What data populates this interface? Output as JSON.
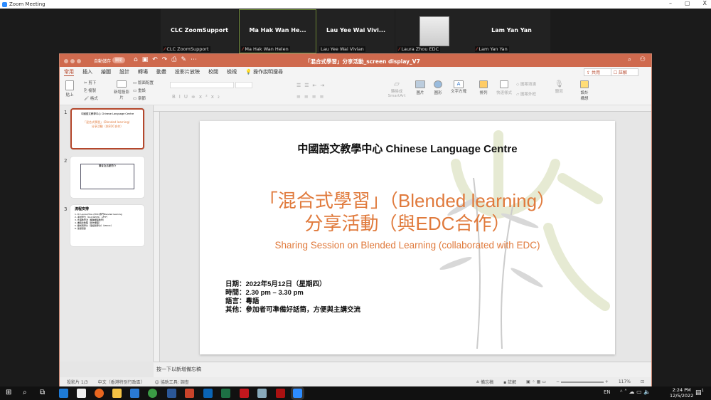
{
  "zoom": {
    "title": "Zoom Meeting",
    "window_controls": [
      "–",
      "▢",
      "X"
    ],
    "participants": [
      {
        "name": "CLC ZoomSupport",
        "label": "CLC ZoomSupport",
        "muted": true
      },
      {
        "name": "Ma Hak Wan He...",
        "label": "Ma Hak Wan Helen",
        "muted": true,
        "active": true
      },
      {
        "name": "Lau Yee Wai Vivi...",
        "label": "Lau Yee Wai Vivian",
        "muted": false
      },
      {
        "name": "",
        "label": "Laura Zhou EDC",
        "muted": true,
        "video": true
      },
      {
        "name": "Lam Yan Yan",
        "label": "Lam Yan Yan",
        "muted": true
      }
    ]
  },
  "ppt": {
    "autosave": "自動儲存",
    "autosave_state": "關閉",
    "doc_title": "「混合式學習」分享活動_screen display_V7",
    "tabs": [
      "常用",
      "插入",
      "繪圖",
      "設計",
      "轉場",
      "動畫",
      "投影片放映",
      "校閱",
      "檢視"
    ],
    "tell_me": "操作說明搜尋",
    "share": "共用",
    "comments": "註解",
    "ribbon": {
      "paste": "貼上",
      "cut": "剪下",
      "copy": "複製",
      "format": "格式",
      "new_slide": "新增投影片",
      "layout": "版面配置",
      "reset": "重設",
      "section": "章節",
      "smartart": "轉換成SmartArt",
      "picture": "圖片",
      "shapes": "圖形",
      "textbox": "文字方塊",
      "arrange": "排列",
      "quick_styles": "快速樣式",
      "shape_fill": "圖案填滿",
      "shape_outline": "圖案外框",
      "dictate": "聽寫",
      "design_ideas": "設計構想"
    },
    "thumbnails": [
      {
        "num": "1",
        "title": "中國語文教學中心 Chinese Language Centre",
        "line1": "「混合式學習」（Blended learning）",
        "line2": "分享活動（與EDC合作）"
      },
      {
        "num": "2",
        "title": "講者及活動簡介"
      },
      {
        "num": "3",
        "title": "流程安排",
        "items": [
          "1. Dr Laura Zhou (EDC)專門Blended learning",
          "2. 考試學分（CLC/GE/PC、pFTF）",
          "3. 外語教學法（翻轉課程教學）",
          "4. 書籍化教程（創作課程）",
          "5. 翻成兩專分（混媒體專分）（MOOC）",
          "6. 答疑環節"
        ]
      }
    ],
    "slide": {
      "header": "中國語文教學中心   Chinese Language Centre",
      "title1": "「混合式學習」（Blended learning）",
      "title2": "分享活動（與EDC合作）",
      "subtitle": "Sharing Session on Blended Learning (collaborated with EDC)",
      "details": [
        "日期：2022年5月12日（星期四）",
        "時間：2.30 pm – 3.30 pm",
        "語言：粵語",
        "其他：參加者可準備好話筒，方便與主講交流"
      ]
    },
    "notes_placeholder": "按一下以新增備忘稿",
    "status": {
      "slide": "投影片 1/3",
      "language": "中文（香港特別行政區）",
      "accessibility": "協助工具: 調查",
      "notes": "備忘稿",
      "comments": "註解",
      "zoom": "117%"
    },
    "accent": "#cf6a4e",
    "slide_orange": "#e07a3c"
  },
  "taskbar": {
    "lang": "EN",
    "time": "2:24 PM",
    "date": "12/5/2022",
    "notification_count": "1"
  }
}
